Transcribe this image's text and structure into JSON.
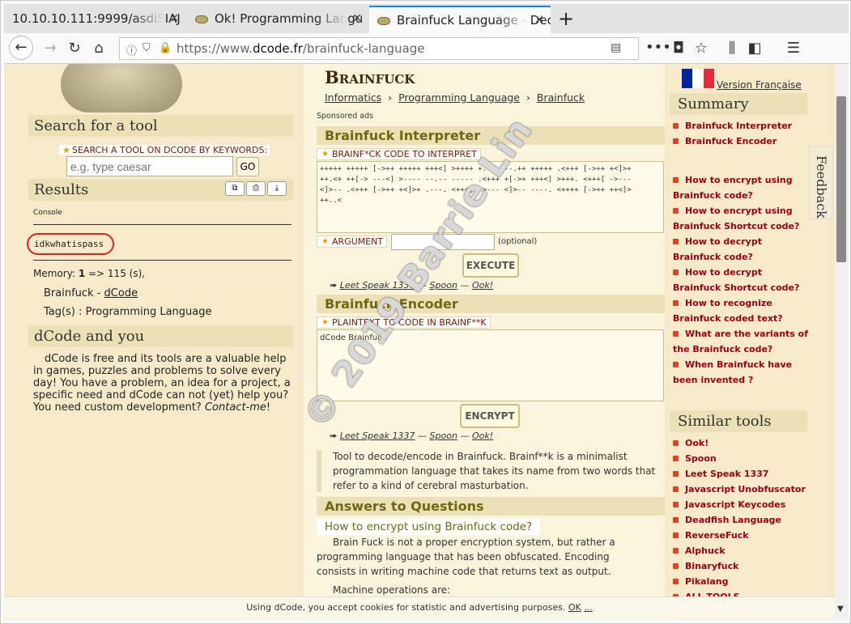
{
  "browser": {
    "tabs": [
      {
        "label": "10.10.10.111:9999/asdiSIAJ"
      },
      {
        "label": "Ok! Programming Langu"
      },
      {
        "label": "Brainfuck Language - Dec"
      }
    ],
    "url_prefix": "https://www.",
    "url_domain": "dcode.fr",
    "url_path": "/brainfuck-language"
  },
  "left": {
    "search_title": "Search for a tool",
    "search_label": "SEARCH A TOOL ON DCODE BY KEYWORDS:",
    "search_placeholder": "e.g. type caesar",
    "go": "GO",
    "results_title": "Results",
    "console_label": "Console",
    "result_value": "idkwhatispass",
    "memory_label": "Memory:",
    "memory_value": "1",
    "memory_rest": "=> 115 (s),",
    "crumb_name": "Brainfuck -",
    "crumb_link": "dCode",
    "tags_label": "Tag(s) :",
    "tags_value": "Programming Language",
    "about_title": "dCode and you",
    "about_text": "dCode is free and its tools are a valuable help in games, puzzles and problems to solve every day! You have a problem, an idea for a project, a specific need and dCode can not (yet) help you? You need custom development?",
    "about_contact": "Contact-me",
    "about_end": "!"
  },
  "main": {
    "title": "Brainfuck",
    "breadcrumb": [
      "Informatics",
      "Programming Language",
      "Brainfuck"
    ],
    "sponsored": "Sponsored ads",
    "interp_title": "Brainfuck Interpreter",
    "code_label": "BRAINF*CK CODE TO INTERPRET",
    "code_value": "+++++ +++++ [->++ +++++ +++<] >++++ +.--- --.++ +++++ .<+++ [->++ +<]>+\n++.<+ ++[-> ---<] >---- --.-- ----- .<+++ +[->+ +++<] >+++. <+++[ ->---\n<]>-- .<+++ [->++ +<]>+ .---. <+++[ ->--- <]>-- ----. <++++ [->++ ++<]>\n++..<",
    "arg_label": "ARGUMENT",
    "arg_opt": "(optional)",
    "execute": "EXECUTE",
    "related1": [
      "Leet Speak 1337",
      "Spoon",
      "Ook!"
    ],
    "enc_title": "Brainfuck Encoder",
    "plain_label": "PLAINTEXT TO CODE IN BRAINF**K",
    "plain_value": "dCode Brainfuck",
    "encrypt": "ENCRYPT",
    "related2": [
      "Leet Speak 1337",
      "Spoon",
      "Ook!"
    ],
    "desc": "Tool to decode/encode in Brainfuck. Brainf**k is a minimalist programmation language that takes its name from two words that refer to a kind of cerebral masturbation.",
    "answers_title": "Answers to Questions",
    "q1": "How to encrypt using Brainfuck code?",
    "a1": "Brain Fuck is not a proper encryption system, but rather a programming language that has been obfuscated. Encoding consists in writing machine code that returns text as output.",
    "a1b": "Machine operations are:",
    "watermark": "© 2019 Barrie Lin"
  },
  "right": {
    "lang": "Version Française",
    "summary_title": "Summary",
    "summary": [
      "Brainfuck Interpreter",
      "Brainfuck Encoder",
      "How to encrypt using Brainfuck code?",
      "How to encrypt using Brainfuck Shortcut code?",
      "How to decrypt Brainfuck code?",
      "How to decrypt Brainfuck Shortcut code?",
      "How to recognize Brainfuck coded text?",
      "What are the variants of the Brainfuck code?",
      "When Brainfuck have been invented ?"
    ],
    "similar_title": "Similar tools",
    "similar": [
      "Ook!",
      "Spoon",
      "Leet Speak 1337",
      "Javascript Unobfuscator",
      "Javascript Keycodes",
      "Deadfish Language",
      "ReverseFuck",
      "Alphuck",
      "Binaryfuck",
      "Pikalang",
      "ALL TOOLS"
    ],
    "feedback": "Feedback"
  },
  "cookie": {
    "text": "Using dCode, you accept cookies for statistic and advertising purposes.",
    "ok": "OK",
    "dots": "..."
  }
}
